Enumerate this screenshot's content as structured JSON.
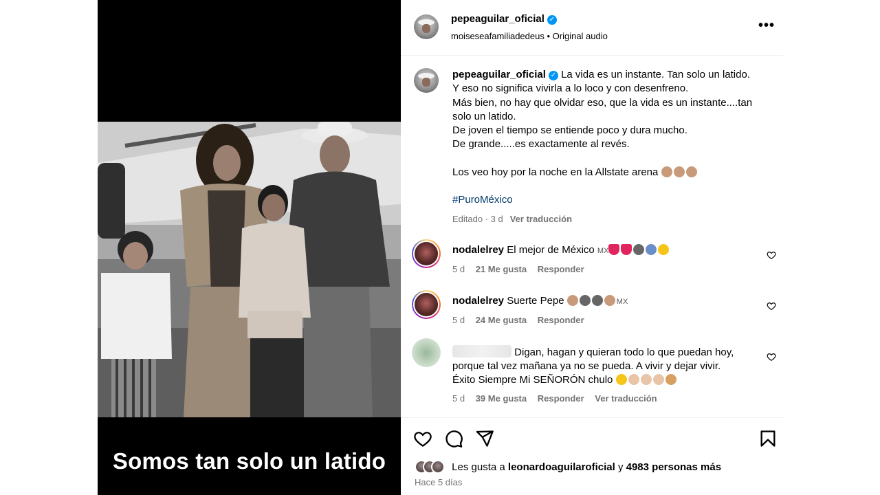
{
  "media": {
    "overlay_caption": "Somos tan solo un latido"
  },
  "header": {
    "username": "pepeaguilar_oficial",
    "audio_user": "moiseseafamiliadedeus",
    "audio_separator": " • ",
    "audio_label": "Original audio"
  },
  "caption": {
    "username": "pepeaguilar_oficial",
    "lines": [
      "La vida es un instante. Tan solo un latido.",
      "Y eso no significa vivirla a lo loco y con desenfreno.",
      "Más bien, no hay que olvidar eso, que la vida es un instante....tan",
      "solo un latido.",
      "De joven el tiempo se entiende poco y dura mucho.",
      "De grande.....es exactamente al revés.",
      "Los veo hoy por la noche en la Allstate arena"
    ],
    "hashtag": "#PuroMéxico",
    "edited": "Editado · 3 d",
    "translate": "Ver traducción"
  },
  "comments": [
    {
      "username": "nodalelrey",
      "text": "El mejor de México",
      "flag_text": "MX",
      "time": "5 d",
      "likes": "21 Me gusta",
      "reply": "Responder"
    },
    {
      "username": "nodalelrey",
      "text": "Suerte Pepe",
      "flag_text": "MX",
      "time": "5 d",
      "likes": "24 Me gusta",
      "reply": "Responder"
    },
    {
      "text_line1": "Digan, hagan y quieran todo lo que puedan hoy,",
      "text_line2": "porque tal vez mañana ya no se pueda. A vivir y dejar vivir.",
      "text_line3": "Éxito Siempre Mi SEÑORÓN chulo",
      "time": "5 d",
      "likes": "39 Me gusta",
      "reply": "Responder",
      "translate": "Ver traducción"
    }
  ],
  "footer": {
    "likes_prefix": "Les gusta a",
    "liked_by": "leonardoaguilaroficial",
    "likes_and": "y",
    "likes_count": "4983 personas más",
    "posted_ago": "Hace 5 días"
  },
  "icons": {
    "like": "heart-icon",
    "comment": "comment-icon",
    "share": "share-icon",
    "save": "bookmark-icon",
    "more": "more-options-icon",
    "verified": "verified-badge-icon"
  },
  "colors": {
    "verified": "#0095f6",
    "secondary_text": "#737373",
    "hashtag": "#00376b",
    "emoji_heart": "#e0245e",
    "emoji_skin": "#c99a7a"
  }
}
